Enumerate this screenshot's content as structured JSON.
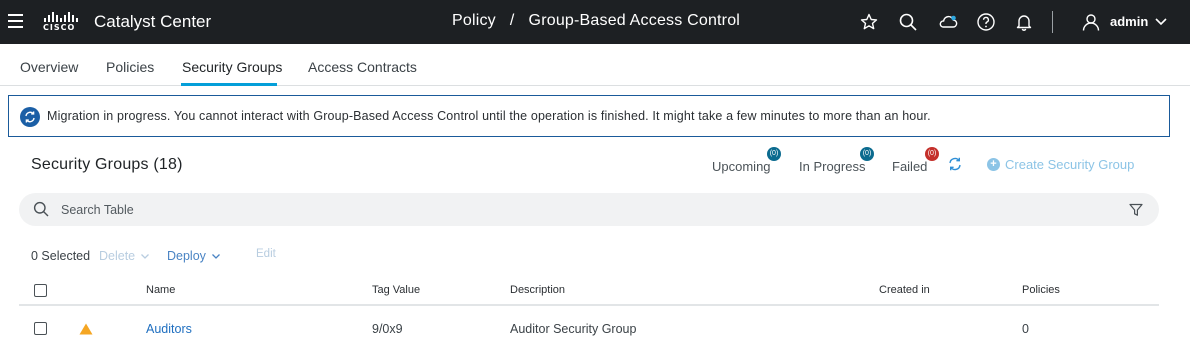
{
  "header": {
    "app_title": "Catalyst Center",
    "logo_text": "CISCO",
    "breadcrumb": [
      "Policy",
      "/",
      "Group-Based Access Control"
    ],
    "user_name": "admin",
    "icons": [
      "menu-icon",
      "cisco-logo",
      "star-icon",
      "search-icon",
      "cloud-icon",
      "help-icon",
      "bell-icon",
      "user-icon",
      "chevron-down-icon"
    ]
  },
  "tabs": [
    {
      "label": "Overview"
    },
    {
      "label": "Policies"
    },
    {
      "label": "Security Groups",
      "active": true
    },
    {
      "label": "Access Contracts"
    }
  ],
  "banner": {
    "text": "Migration in progress. You cannot interact with Group-Based Access Control until the operation is finished. It might take a few minutes to more than an hour."
  },
  "section": {
    "title": "Security Groups (18)",
    "upcoming_label": "Upcoming",
    "upcoming_count": "(0)",
    "in_progress_label": "In Progress",
    "in_progress_count": "(0)",
    "failed_label": "Failed",
    "failed_count": "(0)",
    "create_label": "Create Security Group"
  },
  "search": {
    "placeholder": "Search Table"
  },
  "toolbar": {
    "selected": "0 Selected",
    "delete_label": "Delete",
    "deploy_label": "Deploy",
    "edit_label": "Edit"
  },
  "table": {
    "columns": [
      "Name",
      "Tag Value",
      "Description",
      "Created in",
      "Policies"
    ],
    "rows": [
      {
        "name": "Auditors",
        "tag": "9/0x9",
        "description": "Auditor Security Group",
        "created_in": "",
        "policies": "0",
        "warning": true
      }
    ]
  },
  "colors": {
    "header_bg": "#1d2023",
    "accent": "#049fd9",
    "banner_border": "#1a5a9a",
    "badge_blue": "#0b6b8f",
    "badge_red": "#c4302b",
    "link": "#1f6fc0",
    "warning": "#f5a623"
  }
}
